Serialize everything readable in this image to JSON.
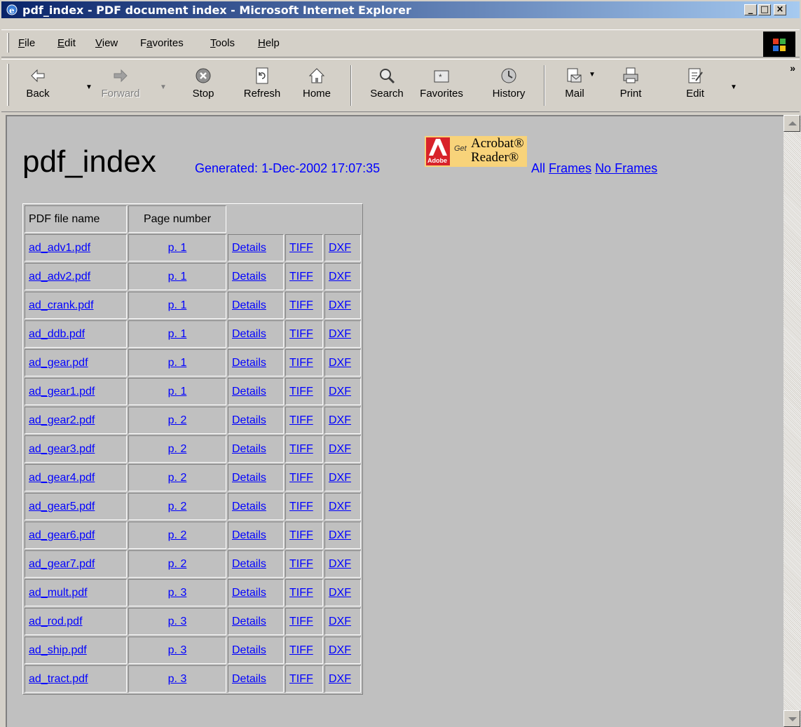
{
  "window": {
    "title": "pdf_index - PDF document index - Microsoft Internet Explorer",
    "controls": [
      "_",
      "□",
      "×"
    ]
  },
  "menu": [
    "File",
    "Edit",
    "View",
    "Favorites",
    "Tools",
    "Help"
  ],
  "toolbar": {
    "buttons": [
      {
        "label": "Back",
        "icon": "back-arrow-icon",
        "enabled": true
      },
      {
        "label": "Forward",
        "icon": "forward-arrow-icon",
        "enabled": false
      },
      {
        "label": "Stop",
        "icon": "stop-icon",
        "enabled": true
      },
      {
        "label": "Refresh",
        "icon": "refresh-icon",
        "enabled": true
      },
      {
        "label": "Home",
        "icon": "home-icon",
        "enabled": true
      },
      {
        "label": "Search",
        "icon": "search-icon",
        "enabled": true
      },
      {
        "label": "Favorites",
        "icon": "favorites-icon",
        "enabled": true
      },
      {
        "label": "History",
        "icon": "history-icon",
        "enabled": true
      },
      {
        "label": "Mail",
        "icon": "mail-icon",
        "enabled": true
      },
      {
        "label": "Print",
        "icon": "print-icon",
        "enabled": true
      },
      {
        "label": "Edit",
        "icon": "edit-icon",
        "enabled": true
      }
    ]
  },
  "page": {
    "title": "pdf_index",
    "generated": "Generated: 1-Dec-2002 17:07:35",
    "acrobat": {
      "brand": "Adobe",
      "get": "Get",
      "line1": "Acrobat®",
      "line2": "Reader®"
    },
    "all_label": "All",
    "frames_link": "Frames",
    "no_frames_link": "No Frames"
  },
  "table": {
    "headers": [
      "PDF file name",
      "Page number"
    ],
    "rows": [
      {
        "file": "ad_adv1.pdf",
        "page": "p. 1",
        "details": "Details",
        "tiff": "TIFF",
        "dxf": "DXF"
      },
      {
        "file": "ad_adv2.pdf",
        "page": "p. 1",
        "details": "Details",
        "tiff": "TIFF",
        "dxf": "DXF"
      },
      {
        "file": "ad_crank.pdf",
        "page": "p. 1",
        "details": "Details",
        "tiff": "TIFF",
        "dxf": "DXF"
      },
      {
        "file": "ad_ddb.pdf",
        "page": "p. 1",
        "details": "Details",
        "tiff": "TIFF",
        "dxf": "DXF"
      },
      {
        "file": "ad_gear.pdf",
        "page": "p. 1",
        "details": "Details",
        "tiff": "TIFF",
        "dxf": "DXF"
      },
      {
        "file": "ad_gear1.pdf",
        "page": "p. 1",
        "details": "Details",
        "tiff": "TIFF",
        "dxf": "DXF"
      },
      {
        "file": "ad_gear2.pdf",
        "page": "p. 2",
        "details": "Details",
        "tiff": "TIFF",
        "dxf": "DXF"
      },
      {
        "file": "ad_gear3.pdf",
        "page": "p. 2",
        "details": "Details",
        "tiff": "TIFF",
        "dxf": "DXF"
      },
      {
        "file": "ad_gear4.pdf",
        "page": "p. 2",
        "details": "Details",
        "tiff": "TIFF",
        "dxf": "DXF"
      },
      {
        "file": "ad_gear5.pdf",
        "page": "p. 2",
        "details": "Details",
        "tiff": "TIFF",
        "dxf": "DXF"
      },
      {
        "file": "ad_gear6.pdf",
        "page": "p. 2",
        "details": "Details",
        "tiff": "TIFF",
        "dxf": "DXF"
      },
      {
        "file": "ad_gear7.pdf",
        "page": "p. 2",
        "details": "Details",
        "tiff": "TIFF",
        "dxf": "DXF"
      },
      {
        "file": "ad_mult.pdf",
        "page": "p. 3",
        "details": "Details",
        "tiff": "TIFF",
        "dxf": "DXF"
      },
      {
        "file": "ad_rod.pdf",
        "page": "p. 3",
        "details": "Details",
        "tiff": "TIFF",
        "dxf": "DXF"
      },
      {
        "file": "ad_ship.pdf",
        "page": "p. 3",
        "details": "Details",
        "tiff": "TIFF",
        "dxf": "DXF"
      },
      {
        "file": "ad_tract.pdf",
        "page": "p. 3",
        "details": "Details",
        "tiff": "TIFF",
        "dxf": "DXF"
      }
    ]
  },
  "colors": {
    "titlebar_start": "#0a246a",
    "titlebar_end": "#a6caf0",
    "link": "#0000ff",
    "page_bg": "#c0c0c0",
    "chrome": "#d4d0c8"
  }
}
